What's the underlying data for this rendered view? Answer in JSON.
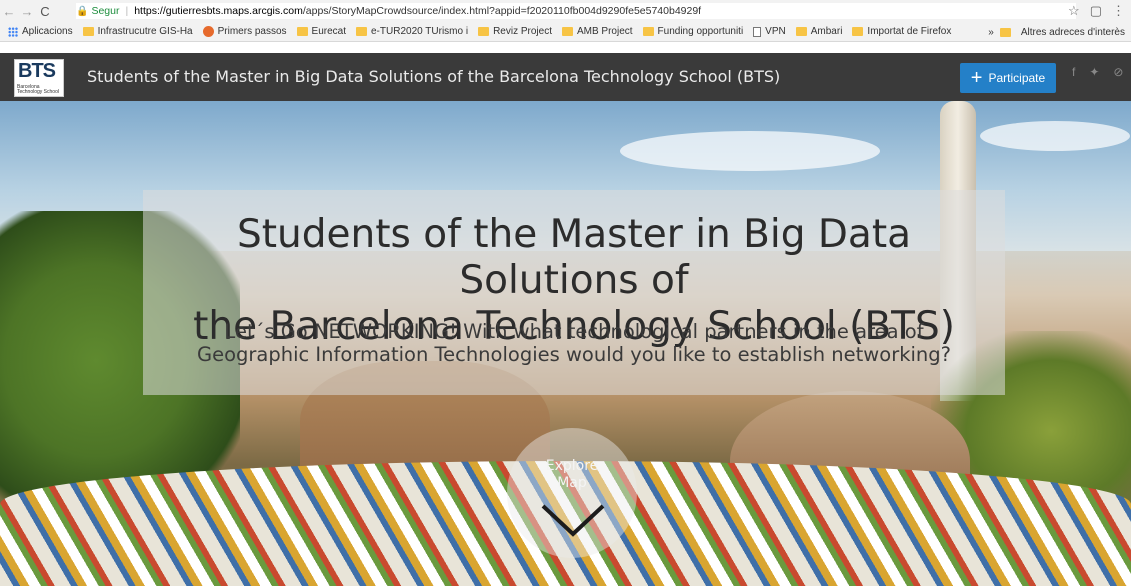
{
  "browser": {
    "secure_label": "Segur",
    "url_host": "https://gutierresbts.maps.arcgis.com",
    "url_path": "/apps/StoryMapCrowdsource/index.html?appid=f2020110fb004d9290fe5e5740b4929f",
    "bookmarks": [
      "Aplicacions",
      "Infrastrucutre GIS-Ha",
      "Primers passos",
      "Eurecat",
      "e-TUR2020 TUrismo i",
      "Reviz Project",
      "AMB Project",
      "Funding opportuniti",
      "VPN",
      "Ambari",
      "Importat de Firefox"
    ],
    "other_bookmarks": "Altres adreces d'interès"
  },
  "header": {
    "logo_text": "BTS",
    "logo_subtext": "Barcelona Technology School",
    "title": "Students of the Master in Big Data Solutions of the Barcelona Technology School (BTS)",
    "participate_label": "Participate",
    "social": [
      "facebook-icon",
      "twitter-icon",
      "link-icon"
    ]
  },
  "hero": {
    "title_line1": "Students of the Master in Big Data Solutions of",
    "title_line2": "the Barcelona Technology School (BTS)",
    "subtitle_line1": "Let´s Go NETWORKING! With what technological partners in the area of",
    "subtitle_line2": "Geographic Information Technologies would you like to establish networking?",
    "explore_line1": "Explore",
    "explore_line2": "Map"
  }
}
